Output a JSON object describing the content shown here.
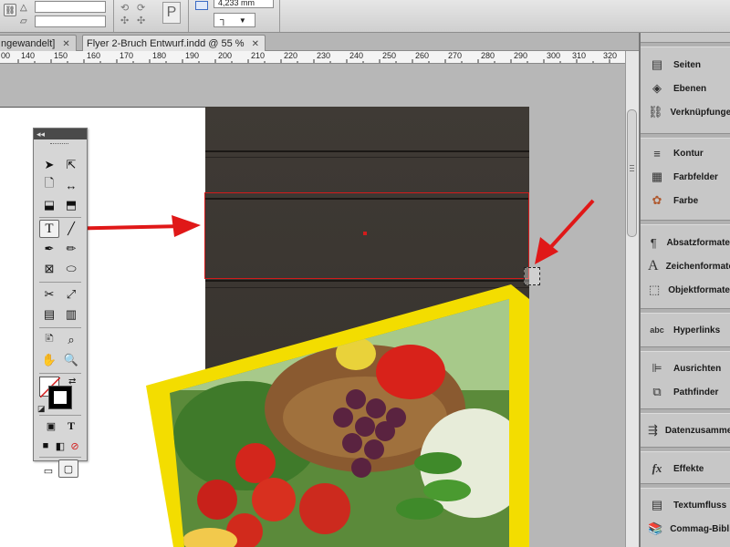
{
  "control_bar": {
    "field_value": "4,233 mm",
    "paragraph_glyph": "P",
    "corner_glyph": "┐",
    "dropdown_arrow": "▼"
  },
  "tabs": [
    {
      "label": "ngewandelt]",
      "active": false,
      "close": "✕"
    },
    {
      "label": "Flyer 2-Bruch Entwurf.indd @ 55 %",
      "active": true,
      "close": "✕"
    }
  ],
  "ruler": {
    "labels": [
      "00",
      "140",
      "150",
      "160",
      "170",
      "180",
      "190",
      "200",
      "210",
      "220",
      "230",
      "240",
      "250",
      "260",
      "270",
      "280",
      "290",
      "300",
      "310",
      "320"
    ]
  },
  "toolbox": {
    "collapse_glyph": "◂◂",
    "type_tool_label": "T",
    "text_format_label": "T"
  },
  "panels": {
    "group1": [
      {
        "label": "Seiten",
        "icon": "pages-icon"
      },
      {
        "label": "Ebenen",
        "icon": "layers-icon"
      },
      {
        "label": "Verknüpfungen",
        "icon": "links-icon"
      }
    ],
    "group2": [
      {
        "label": "Kontur",
        "icon": "stroke-icon"
      },
      {
        "label": "Farbfelder",
        "icon": "swatches-icon"
      },
      {
        "label": "Farbe",
        "icon": "color-icon"
      }
    ],
    "group3": [
      {
        "label": "Absatzformate",
        "icon": "paragraph-styles-icon"
      },
      {
        "label": "Zeichenformate",
        "icon": "character-styles-icon"
      },
      {
        "label": "Objektformate",
        "icon": "object-styles-icon"
      }
    ],
    "group4": [
      {
        "label": "Hyperlinks",
        "icon": "hyperlinks-icon",
        "glyph": "abc"
      }
    ],
    "group5": [
      {
        "label": "Ausrichten",
        "icon": "align-icon"
      },
      {
        "label": "Pathfinder",
        "icon": "pathfinder-icon"
      }
    ],
    "group6": [
      {
        "label": "Datenzusammenführung",
        "icon": "data-merge-icon"
      }
    ],
    "group7": [
      {
        "label": "Effekte",
        "icon": "effects-icon",
        "glyph": "fx"
      }
    ],
    "group8": [
      {
        "label": "Textumfluss",
        "icon": "text-wrap-icon"
      },
      {
        "label": "Commag-Bibliothek",
        "icon": "library-icon"
      }
    ]
  },
  "colors": {
    "annotation_arrow": "#e01818",
    "frame_border": "#d31b1b",
    "photo_border": "#f3dd00",
    "wood": "#3a3530"
  }
}
